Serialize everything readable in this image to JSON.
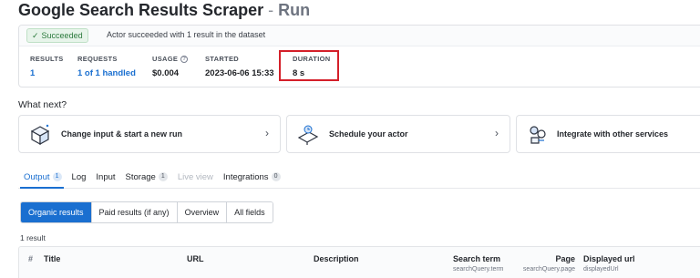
{
  "header": {
    "title": "Google Search Results Scraper",
    "separator": "-",
    "run_label": "Run"
  },
  "status": {
    "badge": "Succeeded",
    "message": "Actor succeeded with 1 result in the dataset"
  },
  "stats": [
    {
      "label": "RESULTS",
      "value": "1"
    },
    {
      "label": "REQUESTS",
      "value": "1 of 1 handled"
    },
    {
      "label": "USAGE",
      "value": "$0.004"
    },
    {
      "label": "STARTED",
      "value": "2023-06-06 15:33"
    },
    {
      "label": "DURATION",
      "value": "8 s"
    }
  ],
  "whatnext": {
    "heading": "What next?",
    "cards": [
      {
        "label": "Change input & start a new run",
        "icon": "cube-icon"
      },
      {
        "label": "Schedule your actor",
        "icon": "schedule-icon"
      },
      {
        "label": "Integrate with other services",
        "icon": "integrate-icon"
      }
    ]
  },
  "tabs": [
    {
      "label": "Output",
      "count": "1"
    },
    {
      "label": "Log",
      "count": ""
    },
    {
      "label": "Input",
      "count": ""
    },
    {
      "label": "Storage",
      "count": "1"
    },
    {
      "label": "Live view",
      "count": ""
    },
    {
      "label": "Integrations",
      "count": "0"
    }
  ],
  "views": [
    "Organic results",
    "Paid results (if any)",
    "Overview",
    "All fields"
  ],
  "result_count": "1 result",
  "table": {
    "columns": [
      {
        "title": "#",
        "sub": ""
      },
      {
        "title": "Title",
        "sub": ""
      },
      {
        "title": "URL",
        "sub": ""
      },
      {
        "title": "Description",
        "sub": ""
      },
      {
        "title": "Search term",
        "sub": "searchQuery.term"
      },
      {
        "title": "Page",
        "sub": "searchQuery.page"
      },
      {
        "title": "Displayed url",
        "sub": "displayedUrl"
      }
    ]
  },
  "colors": {
    "accent": "#1a6fd0",
    "success": "#2b7a3c",
    "highlight": "#d4202a"
  }
}
